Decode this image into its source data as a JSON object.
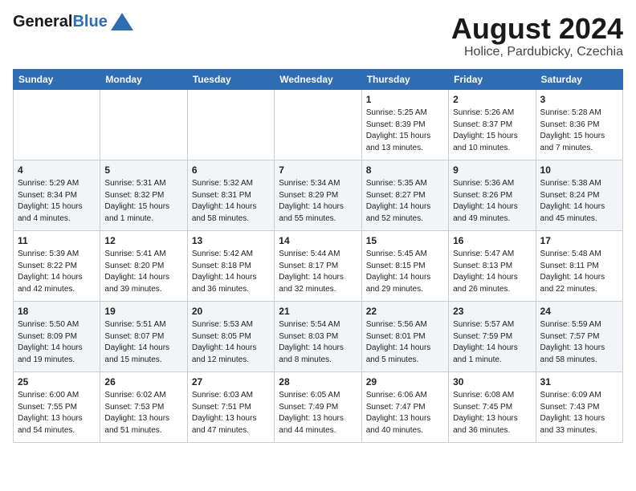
{
  "header": {
    "logo_general": "General",
    "logo_blue": "Blue",
    "month_title": "August 2024",
    "location": "Holice, Pardubicky, Czechia"
  },
  "days_of_week": [
    "Sunday",
    "Monday",
    "Tuesday",
    "Wednesday",
    "Thursday",
    "Friday",
    "Saturday"
  ],
  "weeks": [
    {
      "days": [
        {
          "number": "",
          "info": ""
        },
        {
          "number": "",
          "info": ""
        },
        {
          "number": "",
          "info": ""
        },
        {
          "number": "",
          "info": ""
        },
        {
          "number": "1",
          "info": "Sunrise: 5:25 AM\nSunset: 8:39 PM\nDaylight: 15 hours\nand 13 minutes."
        },
        {
          "number": "2",
          "info": "Sunrise: 5:26 AM\nSunset: 8:37 PM\nDaylight: 15 hours\nand 10 minutes."
        },
        {
          "number": "3",
          "info": "Sunrise: 5:28 AM\nSunset: 8:36 PM\nDaylight: 15 hours\nand 7 minutes."
        }
      ]
    },
    {
      "days": [
        {
          "number": "4",
          "info": "Sunrise: 5:29 AM\nSunset: 8:34 PM\nDaylight: 15 hours\nand 4 minutes."
        },
        {
          "number": "5",
          "info": "Sunrise: 5:31 AM\nSunset: 8:32 PM\nDaylight: 15 hours\nand 1 minute."
        },
        {
          "number": "6",
          "info": "Sunrise: 5:32 AM\nSunset: 8:31 PM\nDaylight: 14 hours\nand 58 minutes."
        },
        {
          "number": "7",
          "info": "Sunrise: 5:34 AM\nSunset: 8:29 PM\nDaylight: 14 hours\nand 55 minutes."
        },
        {
          "number": "8",
          "info": "Sunrise: 5:35 AM\nSunset: 8:27 PM\nDaylight: 14 hours\nand 52 minutes."
        },
        {
          "number": "9",
          "info": "Sunrise: 5:36 AM\nSunset: 8:26 PM\nDaylight: 14 hours\nand 49 minutes."
        },
        {
          "number": "10",
          "info": "Sunrise: 5:38 AM\nSunset: 8:24 PM\nDaylight: 14 hours\nand 45 minutes."
        }
      ]
    },
    {
      "days": [
        {
          "number": "11",
          "info": "Sunrise: 5:39 AM\nSunset: 8:22 PM\nDaylight: 14 hours\nand 42 minutes."
        },
        {
          "number": "12",
          "info": "Sunrise: 5:41 AM\nSunset: 8:20 PM\nDaylight: 14 hours\nand 39 minutes."
        },
        {
          "number": "13",
          "info": "Sunrise: 5:42 AM\nSunset: 8:18 PM\nDaylight: 14 hours\nand 36 minutes."
        },
        {
          "number": "14",
          "info": "Sunrise: 5:44 AM\nSunset: 8:17 PM\nDaylight: 14 hours\nand 32 minutes."
        },
        {
          "number": "15",
          "info": "Sunrise: 5:45 AM\nSunset: 8:15 PM\nDaylight: 14 hours\nand 29 minutes."
        },
        {
          "number": "16",
          "info": "Sunrise: 5:47 AM\nSunset: 8:13 PM\nDaylight: 14 hours\nand 26 minutes."
        },
        {
          "number": "17",
          "info": "Sunrise: 5:48 AM\nSunset: 8:11 PM\nDaylight: 14 hours\nand 22 minutes."
        }
      ]
    },
    {
      "days": [
        {
          "number": "18",
          "info": "Sunrise: 5:50 AM\nSunset: 8:09 PM\nDaylight: 14 hours\nand 19 minutes."
        },
        {
          "number": "19",
          "info": "Sunrise: 5:51 AM\nSunset: 8:07 PM\nDaylight: 14 hours\nand 15 minutes."
        },
        {
          "number": "20",
          "info": "Sunrise: 5:53 AM\nSunset: 8:05 PM\nDaylight: 14 hours\nand 12 minutes."
        },
        {
          "number": "21",
          "info": "Sunrise: 5:54 AM\nSunset: 8:03 PM\nDaylight: 14 hours\nand 8 minutes."
        },
        {
          "number": "22",
          "info": "Sunrise: 5:56 AM\nSunset: 8:01 PM\nDaylight: 14 hours\nand 5 minutes."
        },
        {
          "number": "23",
          "info": "Sunrise: 5:57 AM\nSunset: 7:59 PM\nDaylight: 14 hours\nand 1 minute."
        },
        {
          "number": "24",
          "info": "Sunrise: 5:59 AM\nSunset: 7:57 PM\nDaylight: 13 hours\nand 58 minutes."
        }
      ]
    },
    {
      "days": [
        {
          "number": "25",
          "info": "Sunrise: 6:00 AM\nSunset: 7:55 PM\nDaylight: 13 hours\nand 54 minutes."
        },
        {
          "number": "26",
          "info": "Sunrise: 6:02 AM\nSunset: 7:53 PM\nDaylight: 13 hours\nand 51 minutes."
        },
        {
          "number": "27",
          "info": "Sunrise: 6:03 AM\nSunset: 7:51 PM\nDaylight: 13 hours\nand 47 minutes."
        },
        {
          "number": "28",
          "info": "Sunrise: 6:05 AM\nSunset: 7:49 PM\nDaylight: 13 hours\nand 44 minutes."
        },
        {
          "number": "29",
          "info": "Sunrise: 6:06 AM\nSunset: 7:47 PM\nDaylight: 13 hours\nand 40 minutes."
        },
        {
          "number": "30",
          "info": "Sunrise: 6:08 AM\nSunset: 7:45 PM\nDaylight: 13 hours\nand 36 minutes."
        },
        {
          "number": "31",
          "info": "Sunrise: 6:09 AM\nSunset: 7:43 PM\nDaylight: 13 hours\nand 33 minutes."
        }
      ]
    }
  ]
}
